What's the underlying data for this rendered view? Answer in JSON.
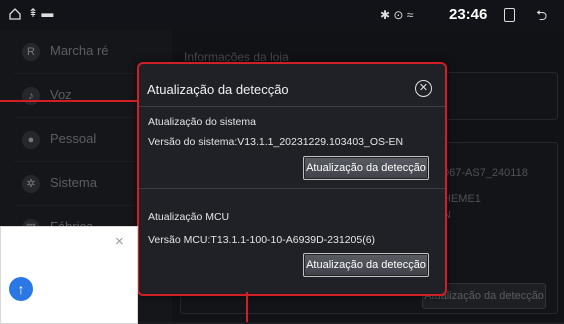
{
  "status_bar": {
    "time": "23:46",
    "usb_icon": "⇞ ▬",
    "signal_icons": "✱ ⊙ ≈"
  },
  "sidebar": {
    "items": [
      {
        "label": "Marcha ré",
        "icon": "reverse-icon",
        "glyph": "R"
      },
      {
        "label": "Voz",
        "icon": "microphone-icon",
        "glyph": "♪"
      },
      {
        "label": "Pessoal",
        "icon": "person-icon",
        "glyph": "●"
      },
      {
        "label": "Sistema",
        "icon": "gear-icon",
        "glyph": "✲"
      },
      {
        "label": "Fábrica",
        "icon": "factory-icon",
        "glyph": "▥"
      }
    ]
  },
  "main": {
    "section_title": "Informações da loja",
    "bg_version": "067-AS7_240118",
    "bg_theme": "HEME1",
    "bg_n": "N",
    "bg_button": "Atualização da detecção"
  },
  "dialog": {
    "title": "Atualização da detecção",
    "system_heading": "Atualização do sistema",
    "system_version": "Versão do sistema:V13.1.1_20231229.103403_OS-EN",
    "system_button": "Atualização da detecção",
    "mcu_heading": "Atualização MCU",
    "mcu_version": "Versão MCU:T13.1.1-100-10-A6939D-231205(6)",
    "mcu_button": "Atualização da detecção"
  },
  "popup": {
    "close_label": "×",
    "upload_icon": "↑"
  },
  "colors": {
    "accent_red": "#d11f26",
    "upload_blue": "#2b78e4"
  }
}
